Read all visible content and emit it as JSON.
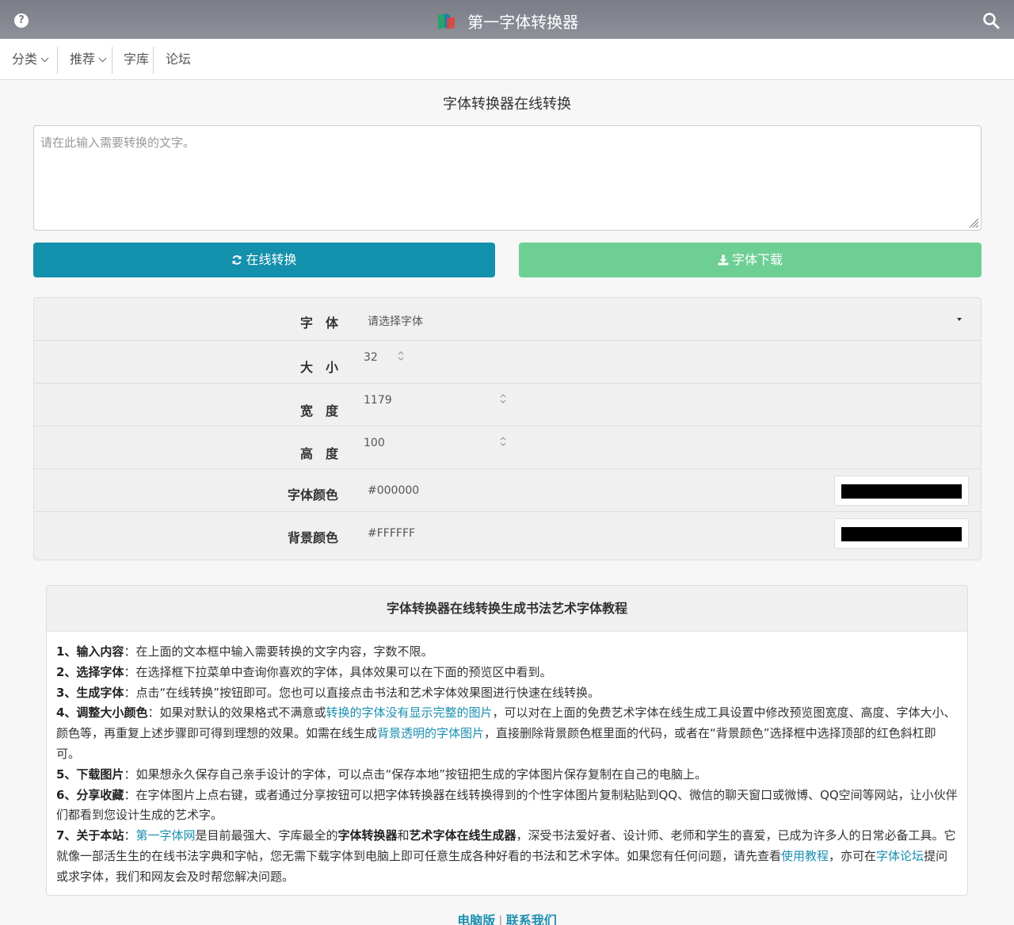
{
  "topbar": {
    "help_icon": "question-circle-icon",
    "logo_icon": "app-logo-icon",
    "title": "第一字体转换器",
    "search_icon": "search-icon"
  },
  "nav": {
    "items": [
      {
        "label": "分类",
        "dropdown": true
      },
      {
        "label": "推荐",
        "dropdown": true
      },
      {
        "label": "字库",
        "dropdown": false
      },
      {
        "label": "论坛",
        "dropdown": false
      }
    ]
  },
  "main": {
    "title": "字体转换器在线转换",
    "text_placeholder": "请在此输入需要转换的文字。",
    "text_value": ""
  },
  "buttons": {
    "convert_label": "在线转换",
    "convert_icon": "refresh-icon",
    "download_label": "字体下载",
    "download_icon": "download-icon",
    "convert_color": "#1390ab",
    "download_color": "#6ecf95"
  },
  "settings": {
    "font_label": "字　体",
    "font_value": "请选择字体",
    "size_label": "大　小",
    "size_value": "32",
    "width_label": "宽　度",
    "width_value": "1179",
    "height_label": "高　度",
    "height_value": "100",
    "font_color_label": "字体颜色",
    "font_color_value": "#000000",
    "bg_color_label": "背景颜色",
    "bg_color_value": "#FFFFFF"
  },
  "tutorial": {
    "title": "字体转换器在线转换生成书法艺术字体教程",
    "s1_head": "1、输入内容",
    "s1_text": "：在上面的文本框中输入需要转换的文字内容，字数不限。",
    "s2_head": "2、选择字体",
    "s2_text": "：在选择框下拉菜单中查询你喜欢的字体，具体效果可以在下面的预览区中看到。",
    "s3_head": "3、生成字体",
    "s3_text": "：点击“在线转换”按钮即可。您也可以直接点击书法和艺术字体效果图进行快速在线转换。",
    "s4_head": "4、调整大小颜色",
    "s4_text_a": "：如果对默认的效果格式不满意或",
    "s4_link_a": "转换的字体没有显示完整的图片",
    "s4_text_b": "，可以对在上面的免费艺术字体在线生成工具设置中修改预览图宽度、高度、字体大小、颜色等，再重复上述步骤即可得到理想的效果。如需在线生成",
    "s4_link_b": "背景透明的字体图片",
    "s4_text_c": "，直接删除背景颜色框里面的代码，或者在“背景颜色”选择框中选择顶部的红色斜杠即可。",
    "s5_head": "5、下载图片",
    "s5_text": "：如果想永久保存自己亲手设计的字体，可以点击“保存本地”按钮把生成的字体图片保存复制在自己的电脑上。",
    "s6_head": "6、分享收藏",
    "s6_text": "：在字体图片上点右键，或者通过分享按钮可以把字体转换器在线转换得到的个性字体图片复制粘贴到QQ、微信的聊天窗口或微博、QQ空间等网站，让小伙伴们都看到您设计生成的艺术字。",
    "s7_head": "7、关于本站",
    "s7_text_a": "：",
    "s7_link_a": "第一字体网",
    "s7_text_b": "是目前最强大、字库最全的",
    "s7_bold_a": "字体转换器",
    "s7_text_c": "和",
    "s7_bold_b": "艺术字体在线生成器",
    "s7_text_d": "，深受书法爱好者、设计师、老师和学生的喜爱，已成为许多人的日常必备工具。它就像一部活生生的在线书法字典和字帖，您无需下载字体到电脑上即可任意生成各种好看的书法和艺术字体。如果您有任何问题，请先查看",
    "s7_link_b": "使用教程",
    "s7_text_e": "，亦可在",
    "s7_link_c": "字体论坛",
    "s7_text_f": "提问或求字体，我们和网友会及时帮您解决问题。"
  },
  "footer": {
    "pc_label": "电脑版",
    "separator": "|",
    "contact_label": "联系我们"
  }
}
